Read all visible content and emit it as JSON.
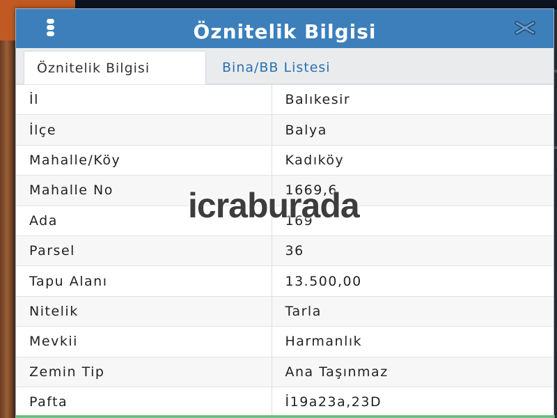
{
  "dialog": {
    "title": "Öznitelik Bilgisi",
    "tabs": [
      {
        "label": "Öznitelik Bilgisi",
        "active": true
      },
      {
        "label": "Bina/BB Listesi",
        "active": false
      }
    ],
    "rows": [
      {
        "key": "İl",
        "value": "Balıkesir"
      },
      {
        "key": "İlçe",
        "value": "Balya"
      },
      {
        "key": "Mahalle/Köy",
        "value": "Kadıköy"
      },
      {
        "key": "Mahalle No",
        "value": "1669,6"
      },
      {
        "key": "Ada",
        "value": "169"
      },
      {
        "key": "Parsel",
        "value": "36"
      },
      {
        "key": "Tapu Alanı",
        "value": "13.500,00"
      },
      {
        "key": "Nitelik",
        "value": "Tarla"
      },
      {
        "key": "Mevkii",
        "value": "Harmanlık"
      },
      {
        "key": "Zemin Tip",
        "value": "Ana Taşınmaz"
      },
      {
        "key": "Pafta",
        "value": "İ19a23a,23D"
      }
    ]
  },
  "watermark": "icraburada",
  "icons": {
    "menu": "menu-dots-icon",
    "close": "close-x-icon"
  },
  "colors": {
    "titlebar": "#3c7fbb",
    "tab_link": "#2a6fae",
    "accent_bottom": "#63c16a"
  }
}
